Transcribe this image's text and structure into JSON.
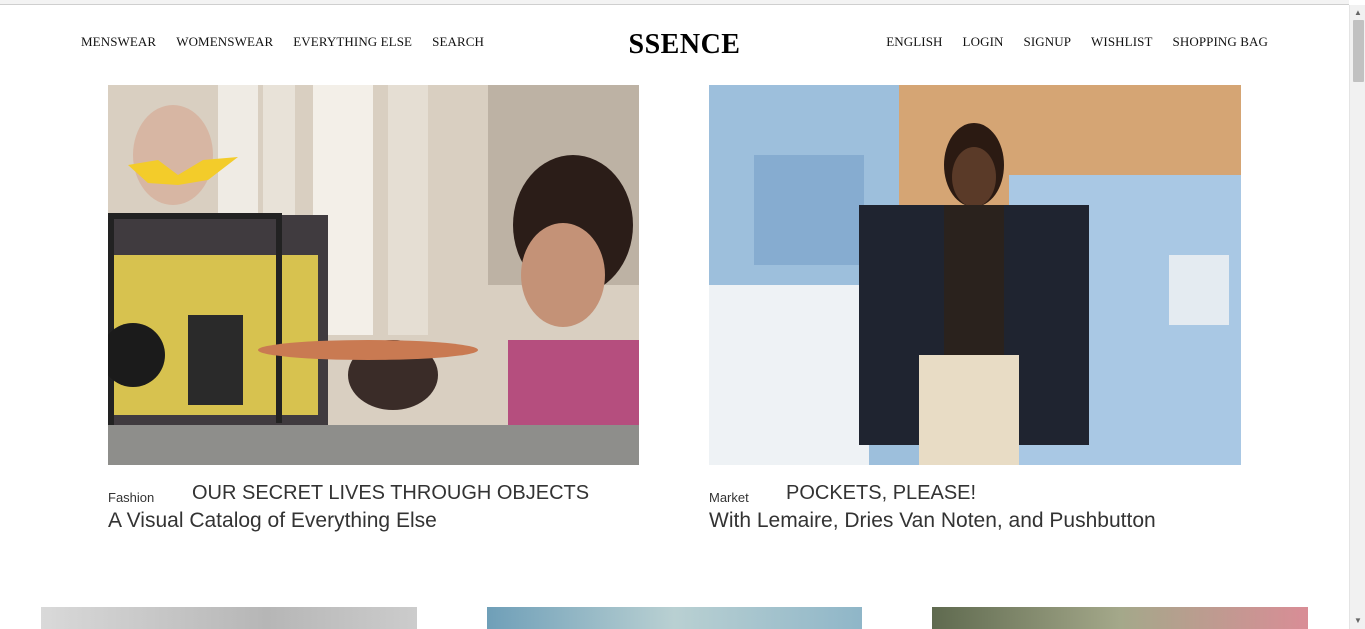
{
  "brand": {
    "logo": "SSENCE"
  },
  "nav_left": [
    "MENSWEAR",
    "WOMENSWEAR",
    "EVERYTHING ELSE",
    "SEARCH"
  ],
  "nav_right": [
    "ENGLISH",
    "LOGIN",
    "SIGNUP",
    "WISHLIST",
    "SHOPPING BAG"
  ],
  "articles": [
    {
      "category": "Fashion",
      "headline": "OUR SECRET LIVES THROUGH OBJECTS",
      "subhead": "A Visual Catalog of Everything Else"
    },
    {
      "category": "Market",
      "headline": "POCKETS, PLEASE!",
      "subhead": "With Lemaire, Dries Van Noten, and Pushbutton"
    }
  ],
  "colors": {
    "text": "#333333",
    "nav_text": "#111111",
    "logo": "#000000",
    "background": "#ffffff"
  },
  "icons": [
    "scroll-up-arrow-icon",
    "scroll-down-arrow-icon"
  ]
}
